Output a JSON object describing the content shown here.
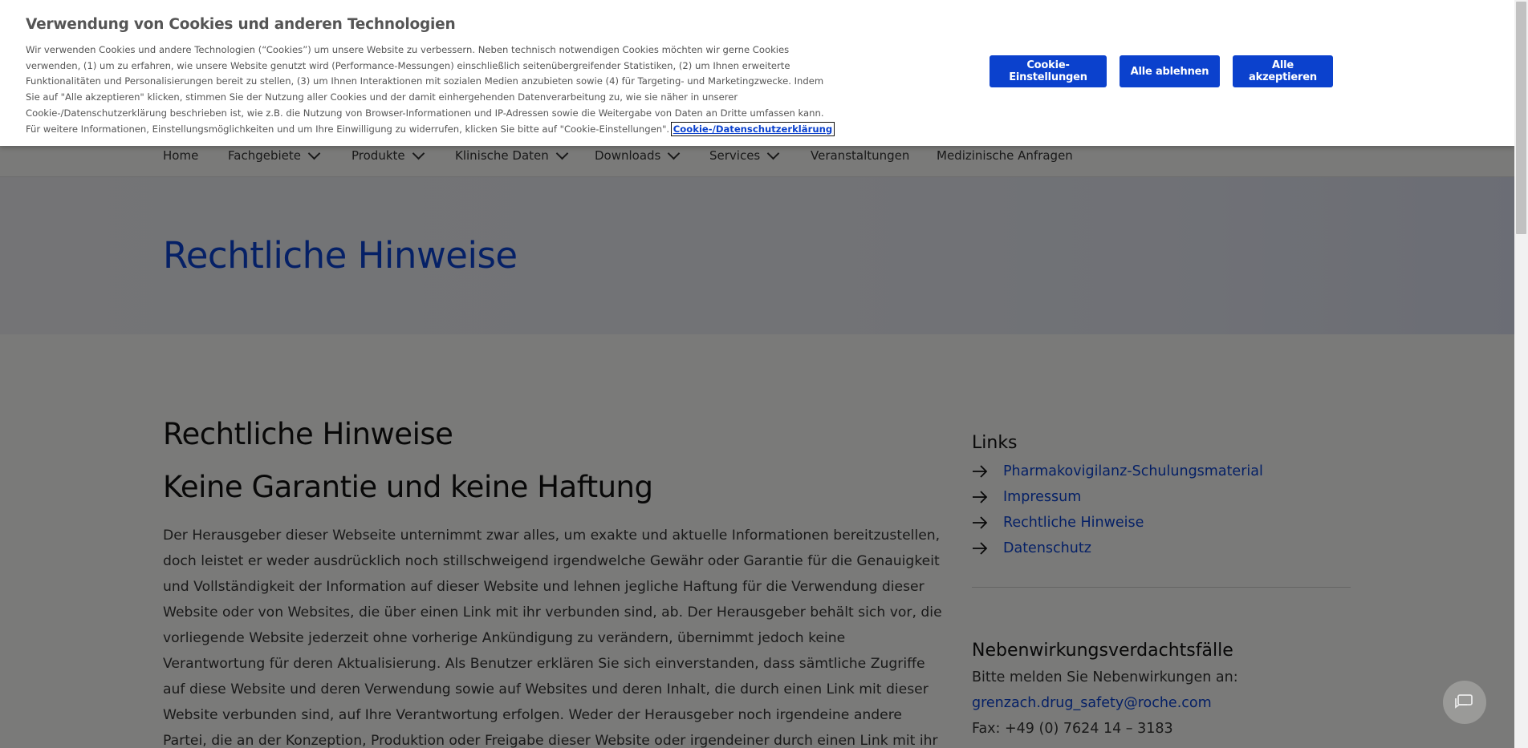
{
  "nav": {
    "items": [
      {
        "label": "Home"
      },
      {
        "label": "Fachgebiete"
      },
      {
        "label": "Produkte"
      },
      {
        "label": "Klinische Daten"
      },
      {
        "label": "Downloads"
      },
      {
        "label": "Services"
      },
      {
        "label": "Veranstaltungen"
      },
      {
        "label": "Medizinische Anfragen"
      }
    ]
  },
  "hero": {
    "title": "Rechtliche Hinweise"
  },
  "main": {
    "heading": "Rechtliche Hinweise",
    "subheading": "Keine Garantie und keine Haftung",
    "paragraph": "Der Herausgeber dieser Webseite unternimmt zwar alles, um exakte und aktuelle Informationen bereitzustellen, doch leistet er weder ausdrücklich noch stillschweigend irgendwelche Gewähr oder Garantie für die Genauigkeit und Vollständigkeit der Information auf dieser Website und lehnen jegliche Haftung für die Verwendung dieser Website oder von Websites, die über einen Link mit ihr verbunden sind, ab. Der Herausgeber behält sich vor, die vorliegende Website jederzeit ohne vorherige Ankündigung zu verändern, übernimmt jedoch keine Verantwortung für deren Aktualisierung. Als Benutzer erklären Sie sich einverstanden, dass sämtliche Zugriffe auf diese Website und deren Verwendung sowie auf Websites und deren Inhalt, die durch einen Link mit dieser Website verbunden sind, auf Ihre Verantwortung erfolgen. Weder der Herausgeber noch irgendeine andere Partei, die an der Konzeption, Produktion oder Freigabe dieser Website oder irgendeiner durch einen Link mit ihr verbundenen Website beteiligt sind, haften auf irgendeine Weise für direkte,"
  },
  "sidebar": {
    "links_title": "Links",
    "links": [
      {
        "label": "Pharmakovigilanz-Schulungsmaterial"
      },
      {
        "label": "Impressum"
      },
      {
        "label": "Rechtliche Hinweise"
      },
      {
        "label": "Datenschutz"
      }
    ],
    "nw_title": "Nebenwirkungsverdachtsfälle",
    "nw_intro": "Bitte melden Sie Nebenwirkungen an:",
    "nw_email": "grenzach.drug_safety@roche.com",
    "nw_fax": "Fax: +49 (0) 7624 14 – 3183"
  },
  "cookie_banner": {
    "title": "Verwendung von Cookies und anderen Technologien",
    "text": "Wir verwenden Cookies und andere Technologien (“Cookies”) um unsere Website zu verbessern. Neben technisch notwendigen Cookies möchten wir gerne Cookies verwenden, (1) um zu erfahren, wie unsere Website genutzt wird (Performance-Messungen) einschließlich seitenübergreifender Statistiken, (2) um Ihnen erweiterte Funktionalitäten und Personalisierungen bereit zu stellen, (3) um Ihnen Interaktionen mit sozialen Medien anzubieten sowie (4) für Targeting- und Marketingzwecke. Indem Sie auf \"Alle akzeptieren\" klicken, stimmen Sie der Nutzung aller Cookies und der damit einhergehenden Datenverarbeitung zu, wie sie näher in unserer Cookie-/Datenschutzerklärung beschrieben ist, wie z.B. die Nutzung von Browser-Informationen und IP-Adressen sowie die Weitergabe von Daten an Dritte umfassen kann. Für weitere Informationen, Einstellungsmöglichkeiten und um Ihre Einwilligung zu widerrufen, klicken Sie bitte auf \"Cookie-Einstellungen\".",
    "link_label": "Cookie-/Datenschutzerklärung",
    "settings_button": "Cookie-Einstellungen",
    "reject_button": "Alle ablehnen",
    "accept_button": "Alle akzeptieren"
  },
  "chat": {
    "icon": "chat-icon"
  },
  "colors": {
    "brand_blue": "#0b41cd",
    "overlay": "rgba(0,0,0,0.5)"
  }
}
